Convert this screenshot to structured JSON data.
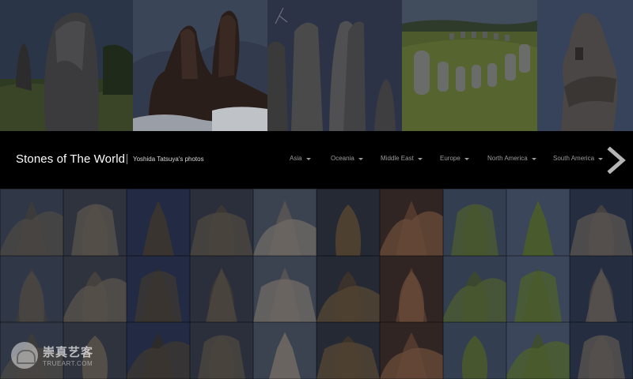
{
  "header": {
    "site_title": "Stones of The World",
    "site_subtitle": "Yoshida Tatsuya's photos"
  },
  "nav": {
    "items": [
      {
        "label": "Asia"
      },
      {
        "label": "Oceania"
      },
      {
        "label": "Middle East"
      },
      {
        "label": "Europe"
      },
      {
        "label": "North America"
      },
      {
        "label": "South America"
      }
    ],
    "next_icon": "chevron-right-icon"
  },
  "hero_photos": [
    {
      "subject": "standing-menhir"
    },
    {
      "subject": "rock-pillars-snow"
    },
    {
      "subject": "tall-standing-stones"
    },
    {
      "subject": "stone-ship-circle"
    },
    {
      "subject": "moai-head"
    }
  ],
  "grid_photos": [
    "cliff-dwelling",
    "carved-rock",
    "pagoda-temple",
    "rock-arch",
    "white-rock-city",
    "boulders",
    "rock-cut-facade",
    "table-mountain",
    "green-valley",
    "rock-edge",
    "ruined-wall",
    "carved-temple",
    "sphinx",
    "gopuram-tower",
    "column-ruins",
    "arch-gate",
    "rock-spire",
    "stone-columns",
    "hoodoos",
    "shore-rock",
    "boulder",
    "stone-face",
    "rock-relief",
    "rock-pillar",
    "stone-tower",
    "carved-head",
    "mountain-peak",
    "mushroom-rock",
    "cliff-carving",
    "arch"
  ],
  "colors": {
    "bar_bg": "#000000",
    "title": "#ffffff",
    "nav_text": "#9b9b9b",
    "arrow": "#b5b5b5"
  },
  "watermark": {
    "text_cn": "崇真艺客",
    "text_en": "TRUEART.COM"
  }
}
